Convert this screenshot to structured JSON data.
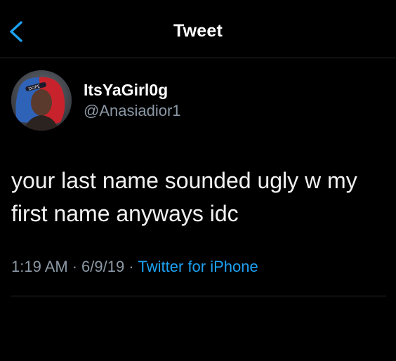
{
  "header": {
    "back_icon": "chevron-left-icon",
    "title": "Tweet"
  },
  "author": {
    "display_name": "ItsYaGirl0g",
    "handle": "@Anasiadior1",
    "avatar_icon": "profile-photo"
  },
  "tweet": {
    "text": "your last name sounded ugly w my first name anyways idc",
    "time": "1:19 AM",
    "separator": "·",
    "date": "6/9/19",
    "source": "Twitter for iPhone"
  },
  "colors": {
    "background": "#000000",
    "text": "#ffffff",
    "secondary_text": "#8b98a5",
    "accent": "#1da1f2",
    "divider": "#2a2a2a"
  }
}
